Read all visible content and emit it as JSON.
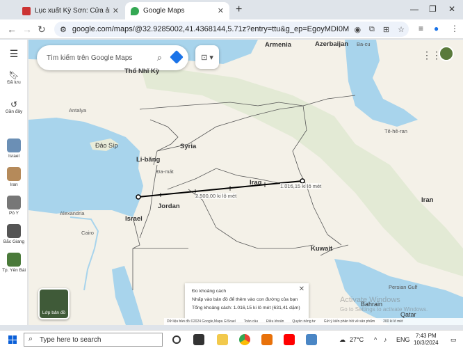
{
  "browser": {
    "tabs": [
      {
        "label": "Lục xuất Kỳ Sơn: Cửa ải 1.300 ·"
      },
      {
        "label": "Google Maps"
      }
    ],
    "new_tab": "+",
    "url": "google.com/maps/@32.9285002,41.4368144,5.71z?entry=ttu&g_ep=EgoyMDI0MDkzMC4wIKX..."
  },
  "maps": {
    "search_placeholder": "Tìm kiếm trên Google Maps",
    "sidebar": [
      {
        "label": "Đã lưu"
      },
      {
        "label": "Gần đây"
      },
      {
        "label": "Israel"
      },
      {
        "label": "Iran"
      },
      {
        "label": "Pô Y"
      },
      {
        "label": "Bắc Giang"
      },
      {
        "label": "Tp. Yên Bái"
      }
    ],
    "labels": {
      "armenia": "Armenia",
      "azerbaijan": "Azerbaijan",
      "bacu": "Ba-cu",
      "thonhiky": "Thổ Nhĩ Kỳ",
      "antalya": "Antalya",
      "daosip": "Đảo Síp",
      "syria": "Syria",
      "libang": "Li-băng",
      "damat": "Đa-mát",
      "iraq": "Iraq",
      "jordan": "Jordan",
      "israel": "Israel",
      "alexandria": "Alexandria",
      "cairo": "Cairo",
      "teheran": "Tê-hê-ran",
      "iran": "Iran",
      "kuwait": "Kuwait",
      "persian": "Persian Gulf",
      "bahrain": "Bahrain",
      "qatar": "Qatar"
    },
    "measure": {
      "mid": "2.500,00 ki lô mét",
      "end": "1.016,15 ki lô mét"
    },
    "layers": "Lớp bản đồ",
    "distance_panel": {
      "title": "Đo khoảng cách",
      "hint": "Nhấp vào bản đồ để thêm vào con đường của bạn",
      "total": "Tổng khoảng cách: 1.016,15 ki lô mét (631,41 dặm)"
    },
    "footer": [
      "Dữ liệu bản đồ ©2024 Google,Mapa GISrael",
      "Toàn cầu",
      "Điều khoản",
      "Quyền riêng tư",
      "Gửi ý kiến phản hồi về sản phẩm",
      "200 ki lô mét"
    ],
    "watermark": {
      "line1": "Activate Windows",
      "line2": "Go to Settings to activate Windows."
    }
  },
  "taskbar": {
    "search": "Type here to search",
    "temp": "27°C",
    "lang": "ENG",
    "time": "7:43 PM",
    "date": "10/3/2024"
  }
}
